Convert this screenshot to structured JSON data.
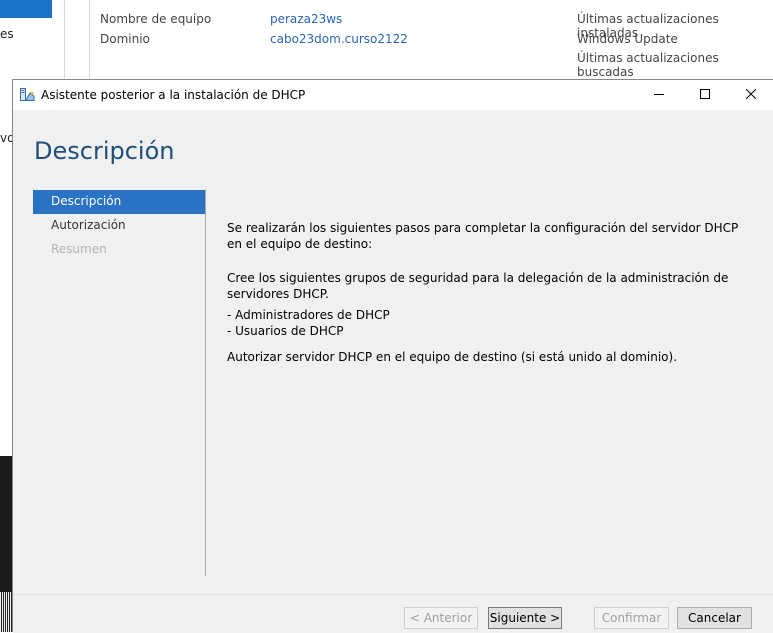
{
  "background": {
    "left_items": [
      "es",
      "vos"
    ],
    "properties": [
      {
        "label": "Nombre de equipo",
        "value": "peraza23ws"
      },
      {
        "label": "Dominio",
        "value": "cabo23dom.curso2122"
      }
    ],
    "right_items": [
      "Últimas actualizaciones instaladas",
      "Windows Update",
      "Últimas actualizaciones buscadas"
    ]
  },
  "dialog": {
    "title": "Asistente posterior a la instalación de DHCP",
    "heading": "Descripción",
    "nav": [
      {
        "label": "Descripción",
        "state": "active"
      },
      {
        "label": "Autorización",
        "state": "normal"
      },
      {
        "label": "Resumen",
        "state": "disabled"
      }
    ],
    "content": {
      "p1": "Se realizarán los siguientes pasos para completar la configuración del servidor DHCP en el equipo de destino:",
      "p2": "Cree los siguientes grupos de seguridad para la delegación de la administración de servidores DHCP.",
      "groups": [
        "- Administradores de DHCP",
        "- Usuarios de DHCP"
      ],
      "p3": "Autorizar servidor DHCP en el equipo de destino (si está unido al dominio)."
    },
    "buttons": {
      "back": "< Anterior",
      "next": "Siguiente >",
      "confirm": "Confirmar",
      "cancel": "Cancelar"
    },
    "window_controls": {
      "minimize": "—",
      "maximize": "☐",
      "close": "✕"
    }
  }
}
